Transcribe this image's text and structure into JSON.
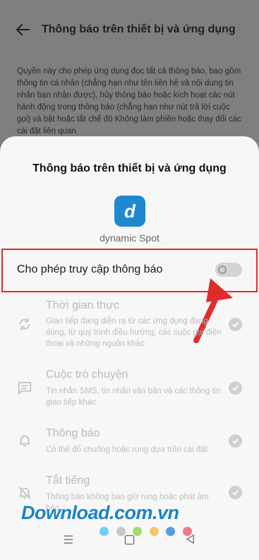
{
  "header": {
    "title": "Thông báo trên thiết bị và ứng dụng"
  },
  "description": "Quyền này cho phép ứng dụng đọc tất cả thông báo, bao gồm thông tin cá nhân (chẳng hạn như tên liên hệ và nội dung tin nhắn bạn nhận được), hủy thông báo hoặc kích hoạt các nút hành động trong thông báo (chẳng hạn như nút trả lời cuộc gọi) và bật hoặc tắt chế độ Không làm phiền hoặc thay đổi các cài đặt liên quan.",
  "sheet": {
    "title": "Thông báo trên thiết bị và ứng dụng",
    "app_icon_letter": "d",
    "app_name": "dynamic Spot",
    "allow_label": "Cho phép truy cập thông báo",
    "allow_enabled": false,
    "permissions": [
      {
        "icon": "sync-icon",
        "title": "Thời gian thực",
        "desc": "Giao tiếp đang diễn ra từ các ứng dụng đang dùng, từ quy trình điều hướng, các cuộc gọi điện thoại và những nguồn khác"
      },
      {
        "icon": "chat-icon",
        "title": "Cuộc trò chuyện",
        "desc": "Tin nhắn SMS, tin nhắn văn bản và các thông tin giao tiếp khác"
      },
      {
        "icon": "bell-icon",
        "title": "Thông báo",
        "desc": "Có thể đổ chuông hoặc rung dựa trên cài đặt"
      },
      {
        "icon": "bell-off-icon",
        "title": "Tắt tiếng",
        "desc": "Thông báo không bao giờ rung hoặc phát âm báo"
      }
    ]
  },
  "watermark": "Download.com.vn",
  "colors": {
    "accent": "#1e88d0",
    "highlight": "#e02b2b",
    "watermark": "#1b84c4"
  },
  "dot_colors": [
    "#6ecff6",
    "#c8c8c8",
    "#a5d86e",
    "#f7c46b",
    "#5b9be0",
    "#ef7a86"
  ]
}
